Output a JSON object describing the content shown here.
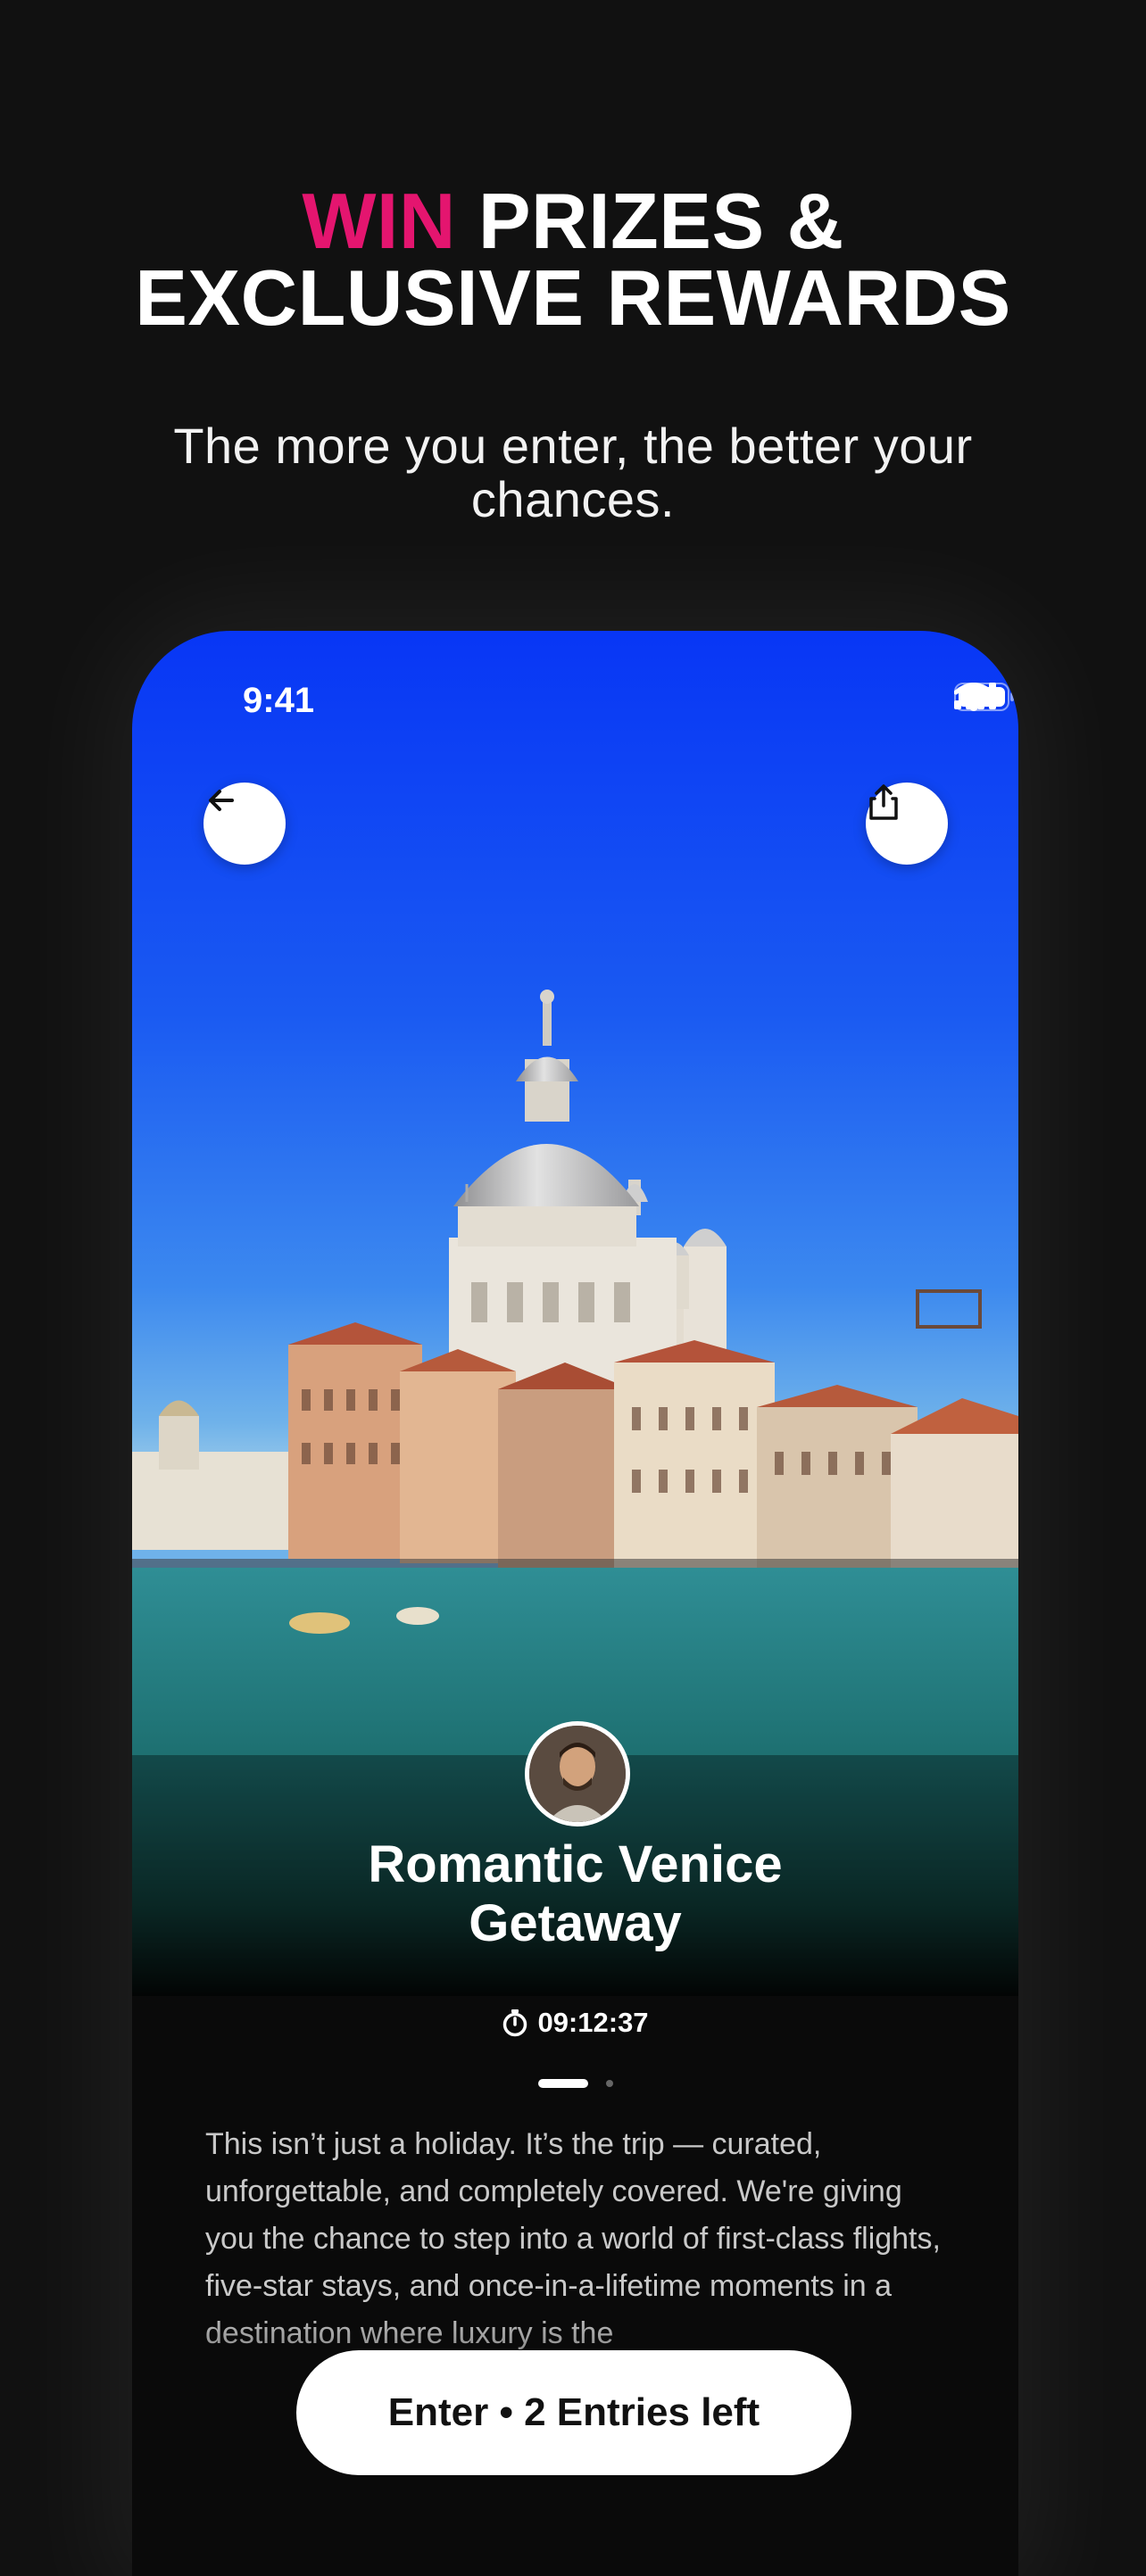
{
  "headline": {
    "accent": "WIN",
    "line1_rest": " PRIZES &",
    "line2": "EXCLUSIVE REWARDS"
  },
  "subhead": "The more you enter, the better your chances.",
  "status_bar": {
    "time": "9:41"
  },
  "prize": {
    "title_line1": "Romantic Venice",
    "title_line2": "Getaway",
    "timer": "09:12:37",
    "description": "This isn’t just a holiday. It’s the trip — curated, unforgettable, and completely covered. We're giving you the chance to step into a world of first-class flights, five-star stays, and once-in-a-lifetime moments in a destination where luxury is the"
  },
  "pager": {
    "count": 2,
    "active_index": 0
  },
  "cta_label": "Enter • 2 Entries left",
  "colors": {
    "accent": "#E4156F",
    "background": "#111111"
  }
}
